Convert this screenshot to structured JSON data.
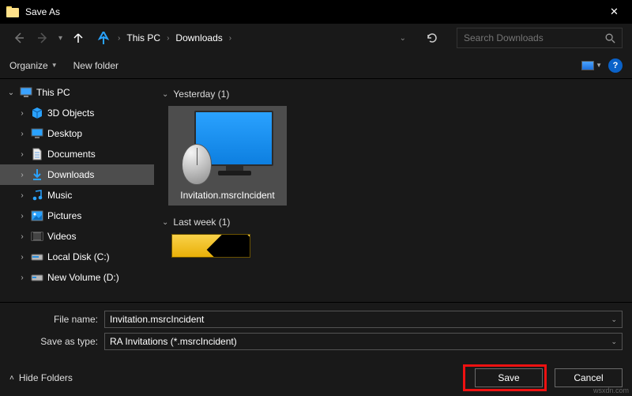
{
  "window": {
    "title": "Save As"
  },
  "nav": {
    "breadcrumbs": [
      "This PC",
      "Downloads"
    ],
    "search_placeholder": "Search Downloads"
  },
  "toolbar": {
    "organize": "Organize",
    "newfolder": "New folder"
  },
  "tree": {
    "root": "This PC",
    "items": [
      {
        "label": "3D Objects",
        "icon": "cube"
      },
      {
        "label": "Desktop",
        "icon": "desktop"
      },
      {
        "label": "Documents",
        "icon": "doc"
      },
      {
        "label": "Downloads",
        "icon": "download",
        "selected": true
      },
      {
        "label": "Music",
        "icon": "music"
      },
      {
        "label": "Pictures",
        "icon": "picture"
      },
      {
        "label": "Videos",
        "icon": "video"
      },
      {
        "label": "Local Disk (C:)",
        "icon": "disk"
      },
      {
        "label": "New Volume (D:)",
        "icon": "disk"
      }
    ]
  },
  "content": {
    "groups": [
      {
        "header": "Yesterday (1)",
        "file": "Invitation.msrcIncident"
      },
      {
        "header": "Last week (1)"
      }
    ]
  },
  "form": {
    "filename_label": "File name:",
    "filename_value": "Invitation.msrcIncident",
    "type_label": "Save as type:",
    "type_value": "RA Invitations (*.msrcIncident)"
  },
  "footer": {
    "hide": "Hide Folders",
    "save": "Save",
    "cancel": "Cancel"
  },
  "watermark": "wsxdn.com"
}
